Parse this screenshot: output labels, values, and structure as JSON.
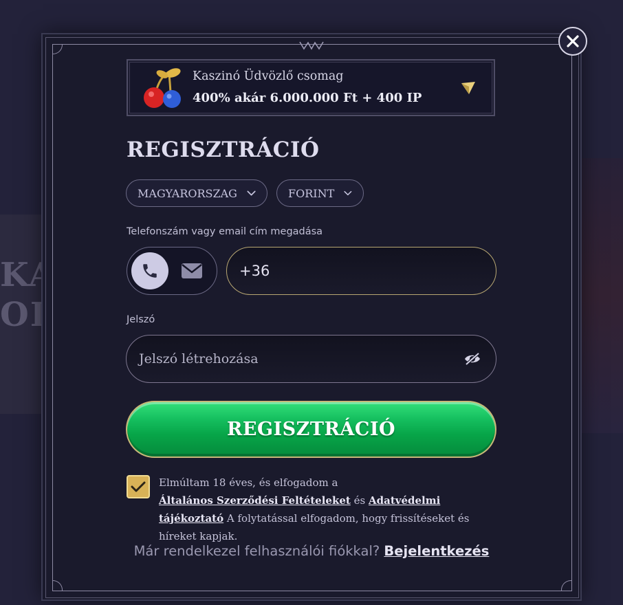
{
  "background": {
    "partial_text_1": "KA",
    "partial_text_2": "ODT"
  },
  "modal": {
    "close_icon": "close-icon",
    "promo": {
      "icon": "cherries-icon",
      "title": "Kaszinó Üdvözlő csomag",
      "subtitle": "400% akár 6.000.000 Ft + 400 IP",
      "chevron": "chevron-down-icon"
    },
    "title": "REGISZTRÁCIÓ",
    "country_select": "MAGYARORSZAG",
    "currency_select": "FORINT",
    "contact_label": "Telefonszám vagy email cím megadása",
    "contact_toggle": {
      "active": "phone-icon",
      "inactive": "mail-icon"
    },
    "phone_prefix": "+36",
    "password_label": "Jelszó",
    "password_placeholder": "Jelszó létrehozása",
    "submit_label": "REGISZTRÁCIÓ",
    "consent": {
      "checked": true,
      "line1": "Elmúltam 18 éves, és elfogadom a",
      "terms_link": "Általános Szerződési Feltételeket",
      "and": "és",
      "privacy_link": "Adatvédelmi tájékoztató",
      "tail": "A folytatással elfogadom, hogy frissítéseket és híreket kapjak."
    },
    "footer": {
      "question": "Már rendelkezel felhasználói fiókkal?",
      "login_link": "Bejelentkezés"
    }
  },
  "colors": {
    "cta_green": "#10b857",
    "gold_border": "#c9b878",
    "checkbox_gold": "#d8b257",
    "modal_bg": "#1a1a2c"
  }
}
